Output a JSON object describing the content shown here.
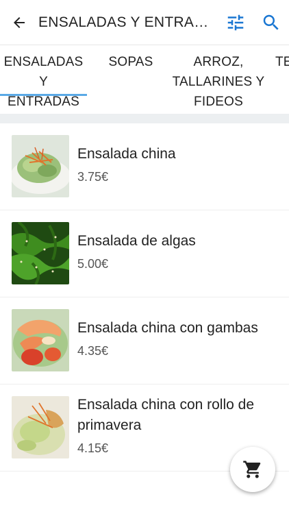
{
  "header": {
    "title": "ENSALADAS Y ENTRAD...",
    "back_icon": "arrow-left-icon",
    "filter_icon": "tune-sliders-icon",
    "search_icon": "search-icon",
    "accent_color": "#1976d2"
  },
  "tabs": [
    {
      "label_line1": "ENSALADAS Y",
      "label_line2": "ENTRADAS",
      "label_line3": "",
      "selected": true
    },
    {
      "label_line1": "SOPAS",
      "label_line2": "",
      "label_line3": "",
      "selected": false
    },
    {
      "label_line1": "ARROZ,",
      "label_line2": "TALLARINES Y",
      "label_line3": "FIDEOS",
      "selected": false
    },
    {
      "label_line1": "TE",
      "label_line2": "",
      "label_line3": "",
      "selected": false
    }
  ],
  "tab_indicator_color": "#5aa9e6",
  "items": [
    {
      "name": "Ensalada china",
      "price": "3.75€"
    },
    {
      "name": "Ensalada de algas",
      "price": "5.00€"
    },
    {
      "name": "Ensalada china con gambas",
      "price": "4.35€"
    },
    {
      "name": "Ensalada china con rollo de primavera",
      "price": "4.15€"
    }
  ],
  "cart_icon": "shopping-cart-icon"
}
